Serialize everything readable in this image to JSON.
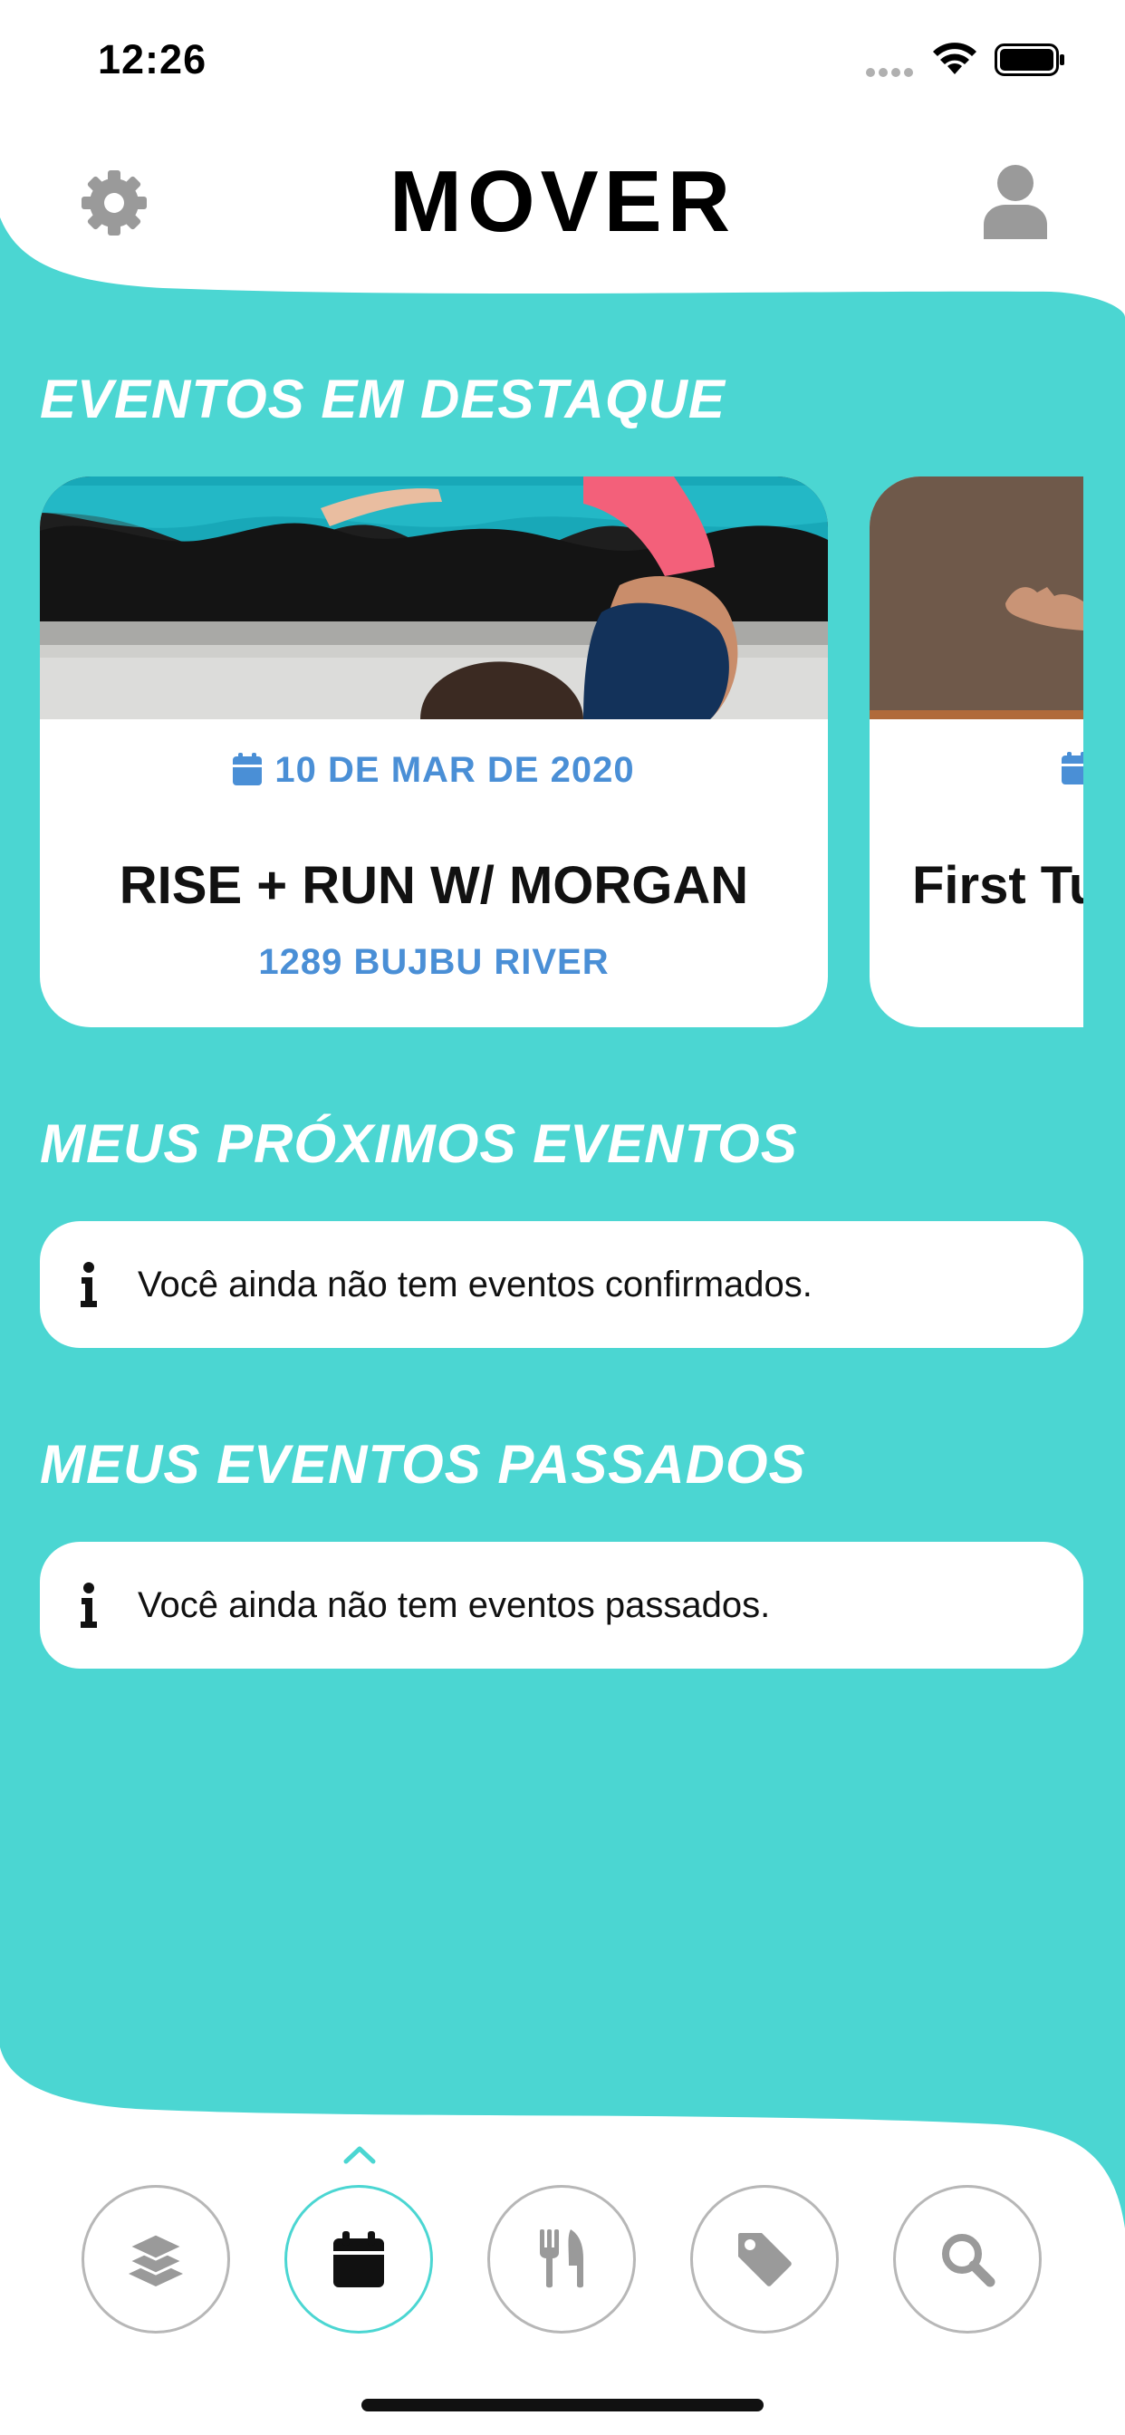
{
  "status_bar": {
    "time": "12:26"
  },
  "header": {
    "title": "MOVER"
  },
  "sections": {
    "featured": "EVENTOS EM DESTAQUE",
    "upcoming": "MEUS PRÓXIMOS EVENTOS",
    "past": "MEUS EVENTOS PASSADOS"
  },
  "featured_events": [
    {
      "date": "10 DE MAR DE 2020",
      "title": "RISE + RUN W/ MORGAN",
      "location": "1289 BUJBU RIVER"
    },
    {
      "title": "First Tu"
    }
  ],
  "upcoming_empty_message": "Você ainda não tem eventos confirmados.",
  "past_empty_message": "Você ainda não tem eventos passados.",
  "bottom_nav": {
    "items": [
      "layers-icon",
      "calendar-icon",
      "utensils-icon",
      "tag-icon",
      "search-icon"
    ],
    "active": "calendar-icon"
  },
  "colors": {
    "teal": "#4bd6d2",
    "accent_blue": "#4a8fd6",
    "icon_gray": "#9a9a9a"
  }
}
